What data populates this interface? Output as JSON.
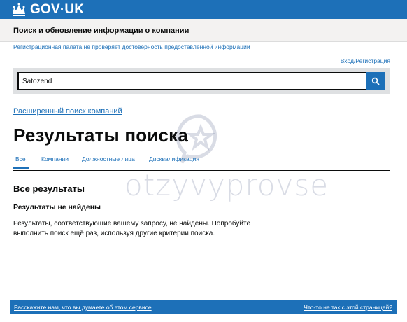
{
  "header": {
    "logo_text": "GOV·UK",
    "service_name": "Поиск и обновление информации о компании"
  },
  "notice": {
    "disclaimer": "Регистрационная палата не проверяет достоверность предоставленной информации",
    "login_link": "Вход/Регистрация"
  },
  "search": {
    "value": "Satozend"
  },
  "advanced_search_link": "Расширенный поиск компаний",
  "page_title": "Результаты поиска",
  "tabs": [
    {
      "label": "Все",
      "active": true
    },
    {
      "label": "Компании",
      "active": false
    },
    {
      "label": "Должностные лица",
      "active": false
    },
    {
      "label": "Дисквалификация",
      "active": false
    }
  ],
  "results": {
    "section_title": "Все результаты",
    "no_results_title": "Результаты не найдены",
    "message": "Результаты, соответствующие вашему запросу, не найдены. Попробуйте выполнить поиск ещё раз, используя другие критерии поиска."
  },
  "watermark": "otzyvyprovse",
  "footer": {
    "feedback_link": "Расскажите нам, что вы думаете об этом сервисе",
    "problem_link": "Что-то не так с этой страницей?"
  },
  "colors": {
    "brand_blue": "#1d70b8",
    "text": "#0b0c0c"
  }
}
